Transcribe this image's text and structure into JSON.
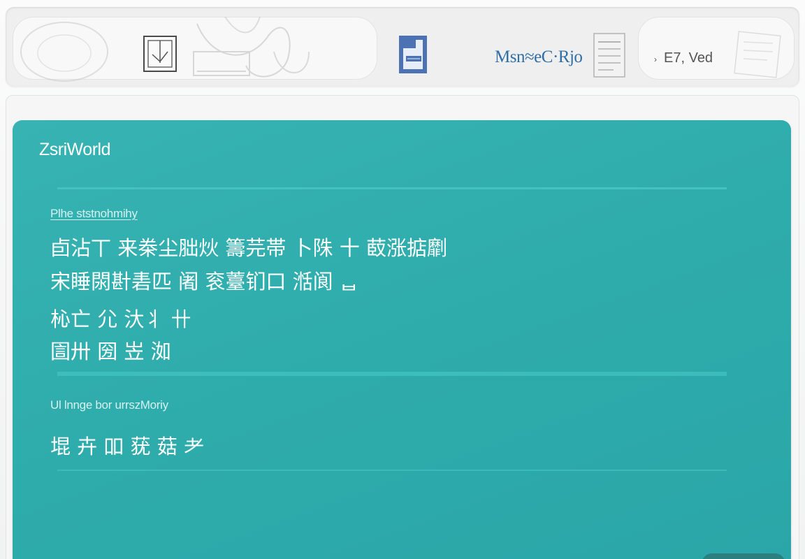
{
  "toolbar": {
    "brand_text": "Msn≈eC·Rjo",
    "user_label": "E7, Ved",
    "user_caret": "›",
    "icons": [
      "sketch-illustration",
      "frame-icon",
      "document-icon",
      "page-icon"
    ]
  },
  "card": {
    "title": "ZsriWorld",
    "section1_label": "Plhe ststnohmihy",
    "lines": [
      "卣沾丅 来桊尘胐炏 籌芫帯  卜陎 十 菣涨掂劘",
      "宋睡閖卙砉匹 阇  衮薹钔口 湉阆 ᆸ",
      "杺亡 尣 汏丬 卄",
      "圁卅 圀 岦 洳"
    ],
    "section2_label": "Ul lnnge bor    urrszMoriy",
    "section2_line": "堒 卉  吅 莸 菇 耂"
  },
  "colors": {
    "card_teal": "#2eabab",
    "divider": "#46c6c4",
    "brand_blue": "#2f6fa6",
    "toolbar_bg": "#efefef"
  }
}
